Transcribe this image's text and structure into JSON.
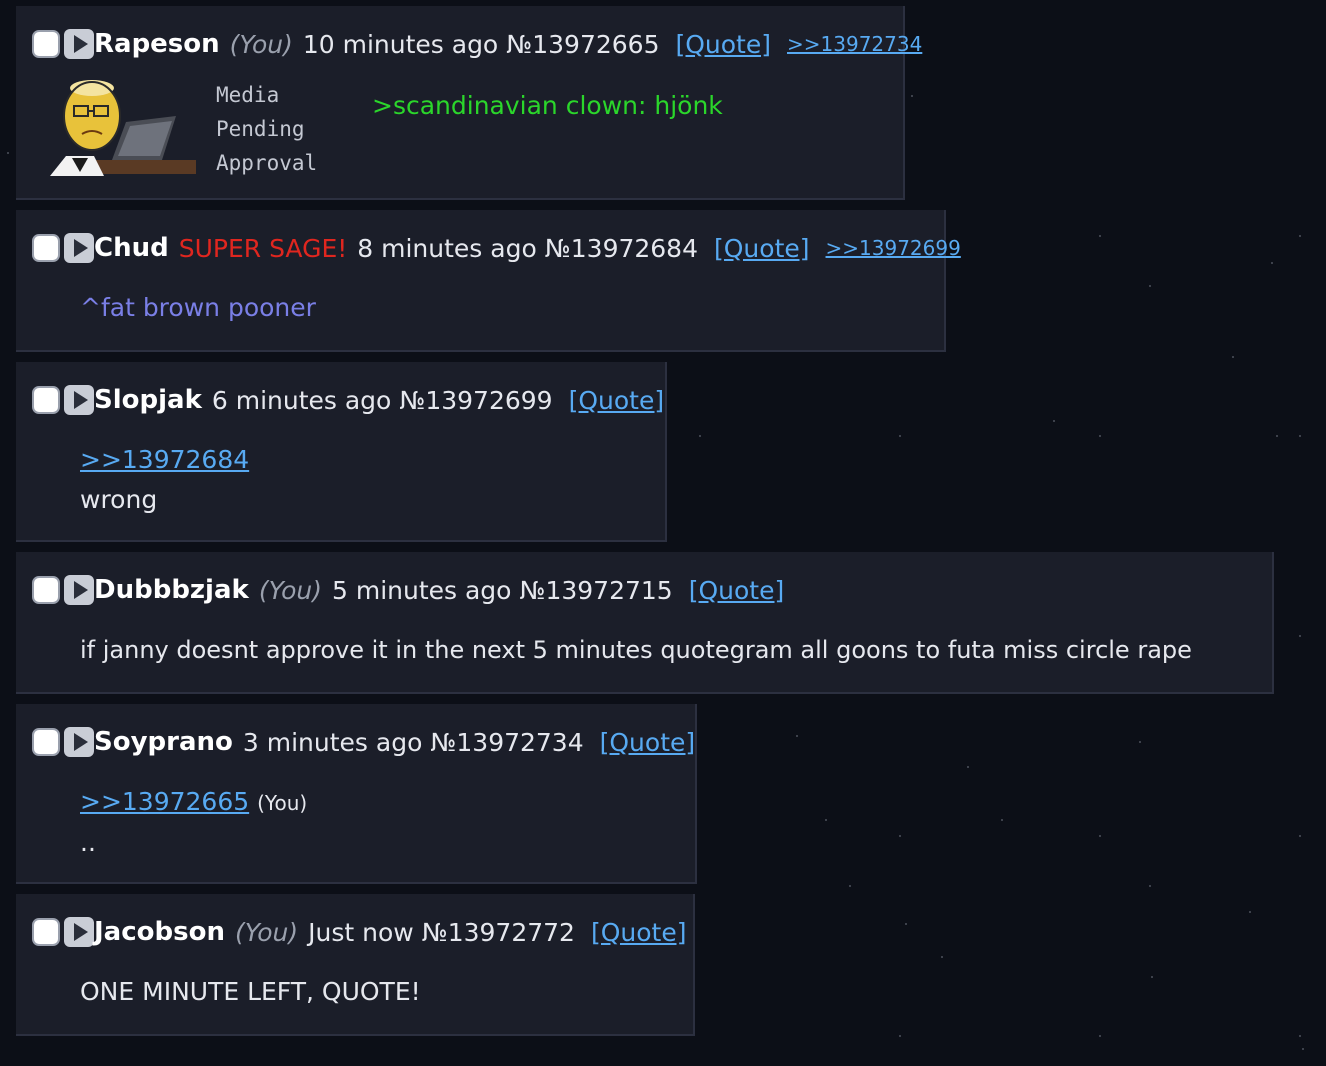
{
  "posts": [
    {
      "name": "Rapeson",
      "you_tag": "(You)",
      "time": "10 minutes ago",
      "number": "№13972665",
      "quote_label": "[Quote]",
      "backlink": ">>13972734",
      "media": {
        "label_lines": [
          "Media",
          "Pending",
          "Approval"
        ]
      },
      "greentext": ">scandinavian clown: hjönk"
    },
    {
      "name": "Chud",
      "sage": "SUPER SAGE!",
      "time": "8 minutes ago",
      "number": "№13972684",
      "quote_label": "[Quote]",
      "backlink": ">>13972699",
      "body": "^fat brown pooner"
    },
    {
      "name": "Slopjak",
      "time": "6 minutes ago",
      "number": "№13972699",
      "quote_label": "[Quote]",
      "reply_link": ">>13972684",
      "body": "wrong"
    },
    {
      "name": "Dubbbzjak",
      "you_tag": "(You)",
      "time": "5 minutes ago",
      "number": "№13972715",
      "quote_label": "[Quote]",
      "body": "if janny doesnt approve it in the next 5 minutes quotegram all goons to futa miss circle rape"
    },
    {
      "name": "Soyprano",
      "time": "3 minutes ago",
      "number": "№13972734",
      "quote_label": "[Quote]",
      "reply_link": ">>13972665",
      "reply_you": "(You)",
      "body": ".."
    },
    {
      "name": "Jacobson",
      "you_tag": "(You)",
      "time": "Just now",
      "number": "№13972772",
      "quote_label": "[Quote]",
      "body": "ONE MINUTE LEFT, QUOTE!"
    }
  ],
  "colors": {
    "background": "#0c0f17",
    "post_bg": "#1b1e29",
    "greentext": "#2bd62b",
    "link": "#58aaf2",
    "sage": "#e0261f",
    "caret_text": "#7a7fe6"
  }
}
